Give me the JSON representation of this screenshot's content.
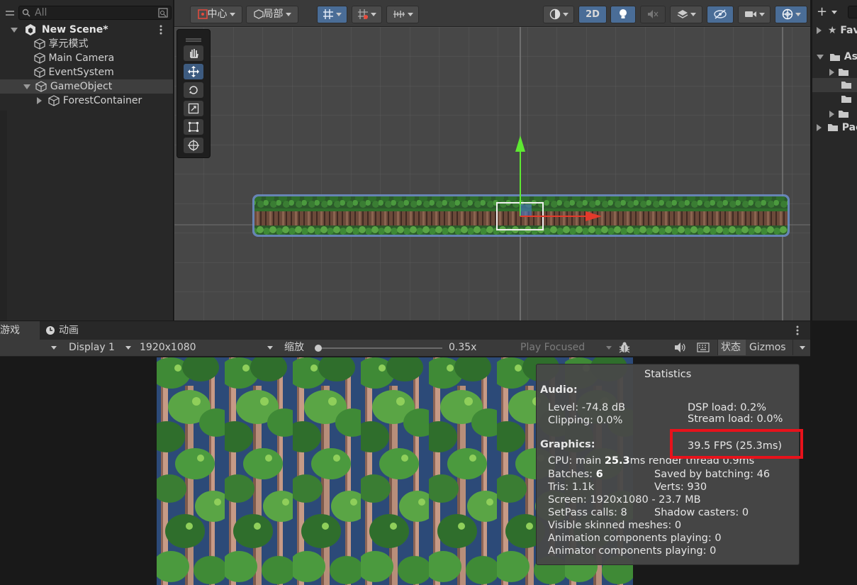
{
  "hierarchy": {
    "search_placeholder": "All",
    "scene_name": "New Scene*",
    "items": [
      {
        "label": "享元模式"
      },
      {
        "label": "Main Camera"
      },
      {
        "label": "EventSystem"
      },
      {
        "label": "GameObject"
      },
      {
        "label": "ForestContainer"
      }
    ]
  },
  "scene_toolbar": {
    "pivot_label": "中心",
    "space_label": "局部",
    "mode_2d_label": "2D"
  },
  "project_panel": {
    "items": [
      {
        "label": "Fav"
      },
      {
        "label": "Ass"
      },
      {
        "label": "Pac"
      }
    ]
  },
  "game_tabs": {
    "game_label": "游戏",
    "animation_label": "动画"
  },
  "game_toolbar": {
    "display": "Display 1",
    "resolution": "1920x1080",
    "scale_label": "缩放",
    "scale_value": "0.35x",
    "scale_fraction": 0.02,
    "play_focused": "Play Focused",
    "stats_label": "状态",
    "gizmos_label": "Gizmos"
  },
  "statistics": {
    "title": "Statistics",
    "audio_header": "Audio:",
    "level": "Level: -74.8 dB",
    "clipping": "Clipping: 0.0%",
    "dsp_load": "DSP load: 0.2%",
    "stream_load": "Stream load: 0.0%",
    "fps": "39.5 FPS (25.3ms)",
    "graphics_header": "Graphics:",
    "cpu_prefix": "CPU: main ",
    "cpu_main": "25.3",
    "cpu_suffix": "ms  render thread 0.9ms",
    "batches_prefix": "Batches: ",
    "batches": "6",
    "saved_by_batching": "Saved by batching: 46",
    "tris": "Tris: 1.1k",
    "verts": "Verts: 930",
    "screen": "Screen: 1920x1080 - 23.7 MB",
    "setpass": "SetPass calls: 8",
    "shadow_casters": "Shadow casters: 0",
    "visible_skinned": "Visible skinned meshes: 0",
    "animation_components": "Animation components playing: 0",
    "animator_components": "Animator components playing: 0"
  },
  "colors": {
    "highlight_box": "#e8121b",
    "active_tool": "#3d5b80",
    "gizmo_y": "#5ee832",
    "gizmo_x": "#e33a2b"
  }
}
